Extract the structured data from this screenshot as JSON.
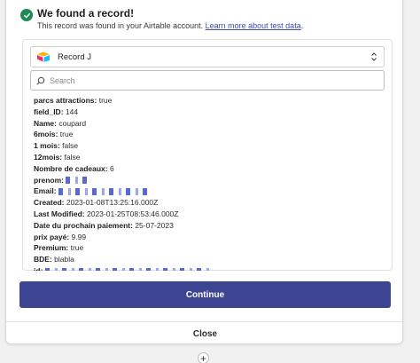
{
  "success": {
    "title": "We found a record!",
    "description": "This record was found in your Airtable account.",
    "link": "Learn more about test data",
    "link_suffix": "."
  },
  "record_select": {
    "value": "Record J",
    "icon": "airtable-logo-icon"
  },
  "search": {
    "placeholder": "Search"
  },
  "fields": [
    {
      "key": "parcs attractions",
      "value": "true"
    },
    {
      "key": "field_ID",
      "value": "144"
    },
    {
      "key": "Name",
      "value": "coupard"
    },
    {
      "key": "6mois",
      "value": "true"
    },
    {
      "key": "1 mois",
      "value": "false"
    },
    {
      "key": "12mois",
      "value": "false"
    },
    {
      "key": "Nombre de cadeaux",
      "value": "6"
    },
    {
      "key": "prenom",
      "value": ""
    },
    {
      "key": "Email",
      "value": ""
    },
    {
      "key": "Created",
      "value": "2023-01-08T13:25:16.000Z"
    },
    {
      "key": "Last Modified",
      "value": "2023-01-25T08:53:46.000Z"
    },
    {
      "key": "Date du prochain paiement",
      "value": "25-07-2023"
    },
    {
      "key": "prix payé",
      "value": "9.99"
    },
    {
      "key": "Premium",
      "value": "true"
    },
    {
      "key": "BDE",
      "value": "blabla"
    },
    {
      "key": "id",
      "value": ""
    }
  ],
  "buttons": {
    "continue": "Continue",
    "close": "Close",
    "add": "+"
  },
  "colors": {
    "primary": "#3d4592",
    "success": "#1f8a54",
    "link": "#3a49b2"
  }
}
